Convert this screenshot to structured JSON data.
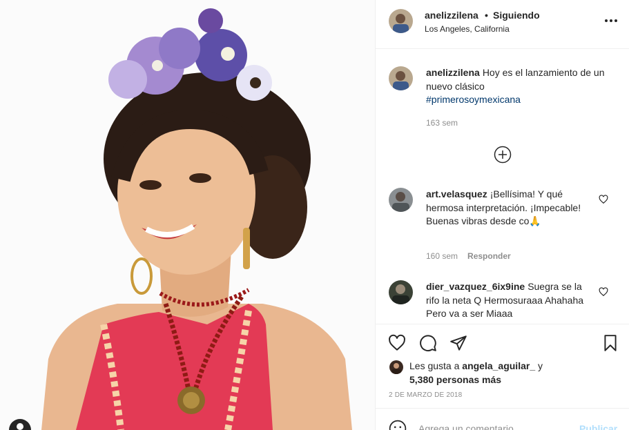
{
  "post": {
    "author": "anelizzilena",
    "separator": "•",
    "follow_status": "Siguiendo",
    "location": "Los Angeles, California",
    "more_icon": "more-horizontal-icon",
    "caption": {
      "user": "anelizzilena",
      "text": "Hoy es el lanzamiento de un nuevo clásico",
      "hashtag": "#primerosoymexicana",
      "time": "163 sem"
    }
  },
  "load_more_icon": "plus-circle-icon",
  "comments": [
    {
      "user": "art.velasquez",
      "text": "¡Bellísima! Y qué hermosa interpretación. ¡Impecable! Buenas vibras desde co🙏",
      "time": "160 sem",
      "reply_label": "Responder"
    },
    {
      "user": "dier_vazquez_6ix9ine",
      "text": "Suegra se la rifo la neta Q Hermosuraaa Ahahaha Pero va a ser Miaaa",
      "time": "",
      "reply_label": ""
    }
  ],
  "actions": {
    "like_icon": "heart-icon",
    "comment_icon": "comment-icon",
    "share_icon": "send-icon",
    "save_icon": "bookmark-icon"
  },
  "likes": {
    "prefix": "Les gusta a",
    "first_user": "angela_aguilar_",
    "connector": "y",
    "others": "5,380 personas más"
  },
  "date": "2 DE MARZO DE 2018",
  "comment_box": {
    "placeholder": "Agrega un comentario...",
    "publish_label": "Publicar"
  },
  "colors": {
    "text": "#262626",
    "secondary": "#8e8e8e",
    "hashtag": "#00376b",
    "publish_disabled": "#b2dffc",
    "border": "#efefef"
  }
}
